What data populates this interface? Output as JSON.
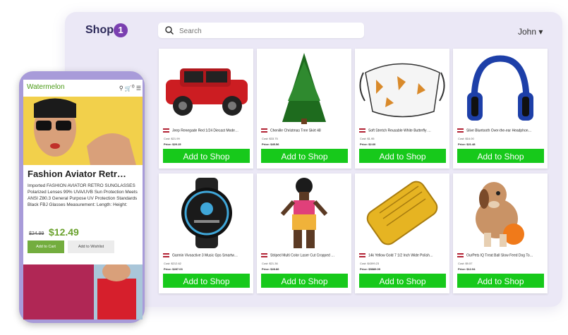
{
  "desktop": {
    "brand": "Shop",
    "brand_badge": "1",
    "search_placeholder": "Search",
    "user_name": "John",
    "user_menu_chevron": "▾",
    "products": [
      {
        "title": "Jeep Renegade Red 1/24 Diecast Mode…",
        "cost": "Cost: $21.99",
        "price": "Price: $29.15",
        "button": "Add to Shop",
        "icon": "toy-car-image"
      },
      {
        "title": "Chenille Christmas Tree Skirt 48",
        "cost": "Cost: $33.75",
        "price": "Price: $45.56",
        "button": "Add to Shop",
        "icon": "christmas-tree-image"
      },
      {
        "title": "Soft Stretch Reusable White Butterfly …",
        "cost": "Cost: $1.95",
        "price": "Price: $2.60",
        "button": "Add to Shop",
        "icon": "face-mask-image"
      },
      {
        "title": "Slive Bluetooth Over-the-ear Headphon…",
        "cost": "Cost: $16.00",
        "price": "Price: $21.48",
        "button": "Add to Shop",
        "icon": "headphones-image"
      },
      {
        "title": "Garmin Vivoactive 3 Music Gps Smartw…",
        "cost": "Cost: $212.62",
        "price": "Price: $287.03",
        "button": "Add to Shop",
        "icon": "smartwatch-image"
      },
      {
        "title": "Striped Multi Color Laser Cut Cropped …",
        "cost": "Cost: $21.36",
        "price": "Price: $28.86",
        "button": "Add to Shop",
        "icon": "dress-model-image"
      },
      {
        "title": "14k Yellow Gold 7 1/2 Inch Wide Polish…",
        "cost": "Cost: $4399.23",
        "price": "Price: $5889.09",
        "button": "Add to Shop",
        "icon": "gold-bracelet-image"
      },
      {
        "title": "OurPets IQ Treat Ball Slow Feed Dog To…",
        "cost": "Cost: $9.57",
        "price": "Price: $12.94",
        "button": "Add to Shop",
        "icon": "dog-toy-image"
      }
    ]
  },
  "mobile": {
    "brand": "Watermelon",
    "cart_count": "0",
    "product_title": "Fashion Aviator Retr…",
    "description": "Imported FASHION AVIATOR RETRO SUNGLASSES Polarized Lenses 99% UVA/UVB Sun Protection Meets ANSI Z80.3 General Purpose UV Protection Standards Black FBJ Glasses Measurement: Length: Height:",
    "old_price": "$24.99",
    "new_price": "$12.49",
    "add_to_cart": "Add to Cart",
    "add_to_wishlist": "Add to Wishlist"
  },
  "colors": {
    "accent_green": "#17c91b",
    "brand_purple": "#7a3fb0",
    "mobile_green": "#73ad3e"
  }
}
